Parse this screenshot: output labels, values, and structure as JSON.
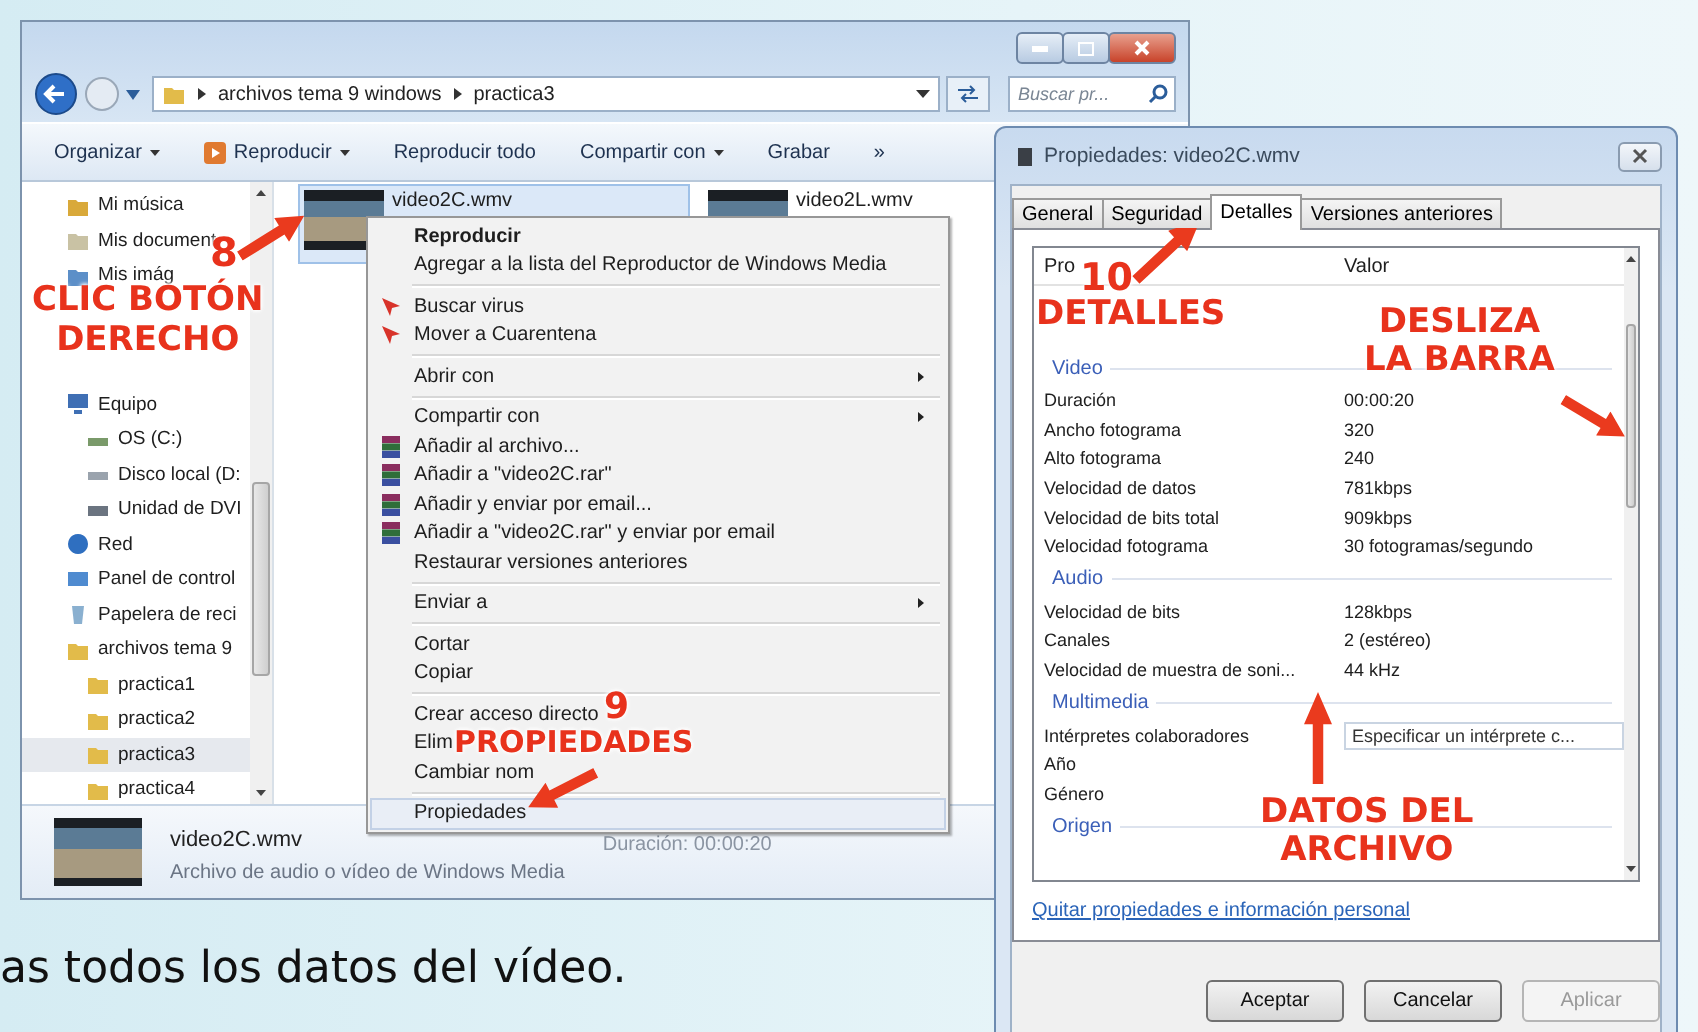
{
  "explorer": {
    "address": {
      "path": [
        "archivos tema 9 windows",
        "practica3"
      ]
    },
    "search": {
      "placeholder": "Buscar pr..."
    },
    "toolbar": [
      {
        "label": "Organizar",
        "kind": "plain",
        "dropdown": true
      },
      {
        "label": "Reproducir",
        "kind": "play",
        "dropdown": true
      },
      {
        "label": "Reproducir todo",
        "kind": "plain",
        "dropdown": false
      },
      {
        "label": "Compartir con",
        "kind": "plain",
        "dropdown": true
      },
      {
        "label": "Grabar",
        "kind": "plain",
        "dropdown": false
      },
      {
        "label": "»",
        "kind": "plain",
        "dropdown": false
      }
    ],
    "nav": [
      {
        "items": [
          {
            "label": "Mi música",
            "kind": "music",
            "selected": false
          },
          {
            "label": "Mis document",
            "kind": "documents",
            "selected": false
          },
          {
            "label": "Mis imág",
            "kind": "pictures",
            "selected": false
          }
        ]
      },
      {
        "items": [
          {
            "label": "Equipo",
            "kind": "computer",
            "selected": false,
            "children": [
              {
                "label": "OS (C:)",
                "kind": "drive",
                "selected": false
              },
              {
                "label": "Disco local (D:",
                "kind": "disk",
                "selected": false
              },
              {
                "label": "Unidad de DVI",
                "kind": "dvd",
                "selected": false
              }
            ]
          },
          {
            "label": "Red",
            "kind": "network",
            "selected": false
          },
          {
            "label": "Panel de control",
            "kind": "control-panel",
            "selected": false
          },
          {
            "label": "Papelera de reci",
            "kind": "recycle-bin",
            "selected": false
          },
          {
            "label": "archivos tema 9",
            "kind": "folder",
            "selected": false,
            "children": [
              {
                "label": "practica1",
                "kind": "folder",
                "selected": false
              },
              {
                "label": "practica2",
                "kind": "folder",
                "selected": false
              },
              {
                "label": "practica3",
                "kind": "folder",
                "selected": true
              },
              {
                "label": "practica4",
                "kind": "folder",
                "selected": false
              }
            ]
          }
        ]
      }
    ],
    "files": [
      {
        "name": "video2C.wmv",
        "selected": true
      },
      {
        "name": "video2L.wmv",
        "selected": false
      }
    ],
    "context_menu": [
      {
        "kind": "item",
        "label": "Reproducir",
        "bold": true,
        "submenu": false,
        "selected": false
      },
      {
        "kind": "item",
        "label": "Agregar a la lista del Reproductor de Windows Media",
        "bold": false,
        "submenu": false,
        "selected": false
      },
      {
        "kind": "separator"
      },
      {
        "kind": "antivirus",
        "label": "Buscar virus",
        "bold": false,
        "submenu": false,
        "selected": false
      },
      {
        "kind": "antivirus",
        "label": "Mover a Cuarentena",
        "bold": false,
        "submenu": false,
        "selected": false
      },
      {
        "kind": "separator"
      },
      {
        "kind": "item",
        "label": "Abrir con",
        "bold": false,
        "submenu": true,
        "selected": false
      },
      {
        "kind": "separator"
      },
      {
        "kind": "item",
        "label": "Compartir con",
        "bold": false,
        "submenu": true,
        "selected": false
      },
      {
        "kind": "archive",
        "label": "Añadir al archivo...",
        "bold": false,
        "submenu": false,
        "selected": false
      },
      {
        "kind": "archive",
        "label": "Añadir a \"video2C.rar\"",
        "bold": false,
        "submenu": false,
        "selected": false
      },
      {
        "kind": "archive",
        "label": "Añadir y enviar por email...",
        "bold": false,
        "submenu": false,
        "selected": false
      },
      {
        "kind": "archive",
        "label": "Añadir a \"video2C.rar\" y enviar por email",
        "bold": false,
        "submenu": false,
        "selected": false
      },
      {
        "kind": "item",
        "label": "Restaurar versiones anteriores",
        "bold": false,
        "submenu": false,
        "selected": false
      },
      {
        "kind": "separator"
      },
      {
        "kind": "item",
        "label": "Enviar a",
        "bold": false,
        "submenu": true,
        "selected": false
      },
      {
        "kind": "separator"
      },
      {
        "kind": "item",
        "label": "Cortar",
        "bold": false,
        "submenu": false,
        "selected": false
      },
      {
        "kind": "item",
        "label": "Copiar",
        "bold": false,
        "submenu": false,
        "selected": false
      },
      {
        "kind": "separator"
      },
      {
        "kind": "item",
        "label": "Crear acceso directo",
        "bold": false,
        "submenu": false,
        "selected": false
      },
      {
        "kind": "item",
        "label": "Elim",
        "bold": false,
        "submenu": false,
        "selected": false
      },
      {
        "kind": "item",
        "label": "Cambiar nom",
        "bold": false,
        "submenu": false,
        "selected": false
      },
      {
        "kind": "separator"
      },
      {
        "kind": "item",
        "label": "Propiedades",
        "bold": false,
        "submenu": false,
        "selected": true
      }
    ],
    "details": {
      "name": "video2C.wmv",
      "type": "Archivo de audio o vídeo de Windows Media",
      "duration": "Duración: 00:00:20"
    }
  },
  "properties": {
    "title": "Propiedades: video2C.wmv",
    "tabs": [
      {
        "label": "General",
        "selected": false
      },
      {
        "label": "Seguridad",
        "selected": false
      },
      {
        "label": "Detalles",
        "selected": true
      },
      {
        "label": "Versiones anteriores",
        "selected": false
      }
    ],
    "columns": [
      "Pro",
      "Valor"
    ],
    "sections": [
      {
        "name": "Video",
        "rows": [
          {
            "property": "Duración",
            "value": "00:00:20"
          },
          {
            "property": "Ancho fotograma",
            "value": "320"
          },
          {
            "property": "Alto fotograma",
            "value": "240"
          },
          {
            "property": "Velocidad de datos",
            "value": "781kbps"
          },
          {
            "property": "Velocidad de bits total",
            "value": "909kbps"
          },
          {
            "property": "Velocidad fotograma",
            "value": "30 fotogramas/segundo"
          }
        ]
      },
      {
        "name": "Audio",
        "rows": [
          {
            "property": "Velocidad de bits",
            "value": "128kbps"
          },
          {
            "property": "Canales",
            "value": "2 (estéreo)"
          },
          {
            "property": "Velocidad de muestra de soni...",
            "value": "44 kHz"
          }
        ]
      },
      {
        "name": "Multimedia",
        "rows": [
          {
            "property": "Intérpretes colaboradores",
            "placeholder": "Especificar un intérprete c..."
          },
          {
            "property": "Año"
          },
          {
            "property": "Género"
          }
        ]
      },
      {
        "name": "Origen"
      }
    ],
    "link": "Quitar propiedades e información personal",
    "buttons": [
      {
        "label": "Aceptar",
        "disabled": false
      },
      {
        "label": "Cancelar",
        "disabled": false
      },
      {
        "label": "Aplicar",
        "disabled": true
      }
    ]
  },
  "annotations": [
    {
      "number": "8",
      "lines": [
        "CLIC BOTÓN",
        "DERECHO"
      ]
    },
    {
      "number": "9",
      "lines": [
        "PROPIEDADES"
      ]
    },
    {
      "number": "10",
      "lines": [
        "DETALLES"
      ]
    },
    {
      "lines": [
        "DESLIZA",
        "LA BARRA"
      ]
    },
    {
      "lines": [
        "DATOS DEL",
        "ARCHIVO"
      ]
    }
  ],
  "caption": "as todos los datos del vídeo."
}
